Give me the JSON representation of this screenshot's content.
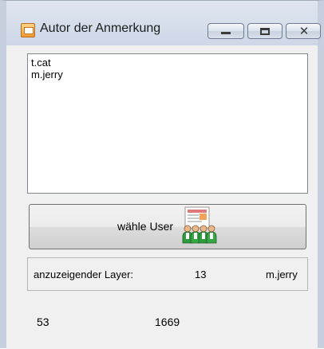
{
  "window": {
    "title": "Autor der Anmerkung",
    "title_icon": "notes-app-icon",
    "controls": {
      "minimize_icon": "minimize-icon",
      "maximize_icon": "maximize-icon",
      "close_glyph": "✕"
    }
  },
  "authors_list": {
    "items": [
      "t.cat",
      "m.jerry"
    ]
  },
  "select_user_button": {
    "label": "wähle User",
    "icon": "users-group-icon"
  },
  "info": {
    "layer_label": "anzuzeigender Layer:",
    "layer_value": "13",
    "current_user": "m.jerry"
  },
  "footer_values": {
    "value_a": "53",
    "value_b": "1669"
  },
  "colors": {
    "titlebar": "#cdd7e6",
    "frame": "#c6cfdd",
    "client": "#f0f0f0",
    "list_background": "#ffffff"
  }
}
